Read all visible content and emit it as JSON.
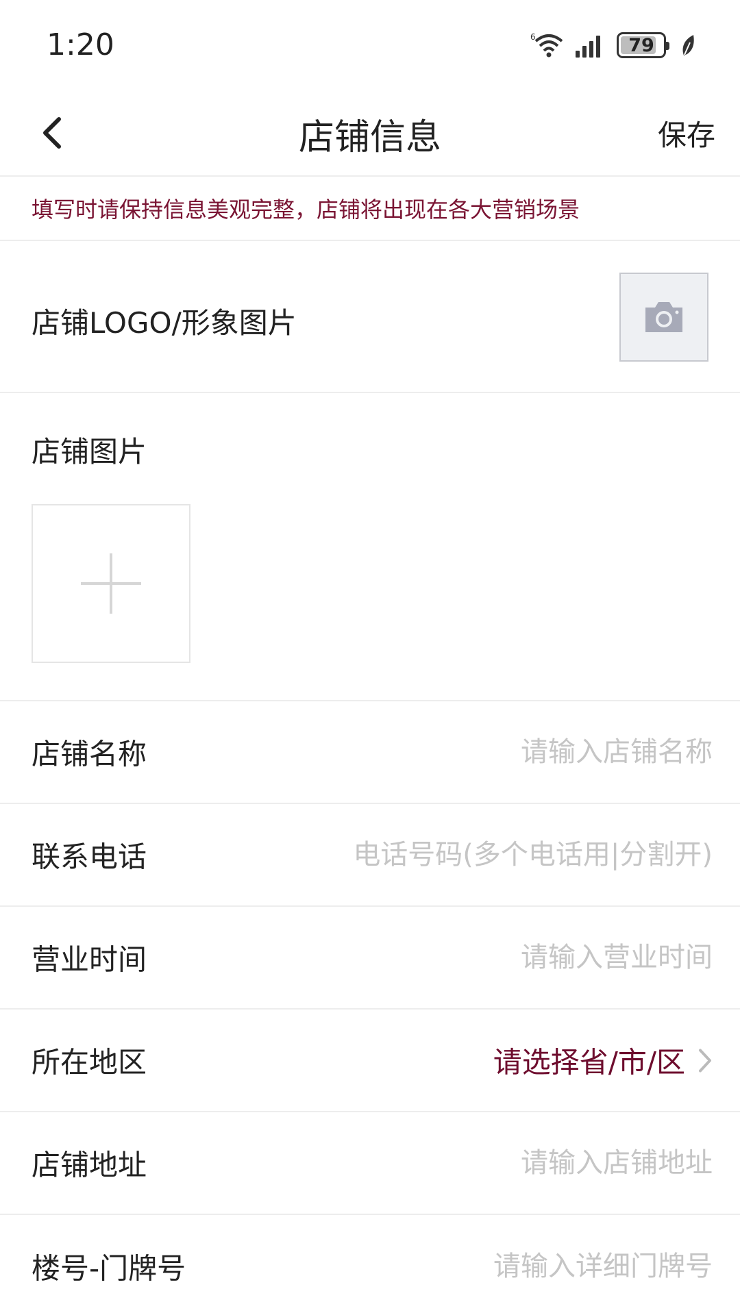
{
  "status_bar": {
    "time": "1:20",
    "battery": "79"
  },
  "header": {
    "title": "店铺信息",
    "save_label": "保存"
  },
  "notice": "填写时请保持信息美观完整，店铺将出现在各大营销场景",
  "logo_section": {
    "label": "店铺LOGO/形象图片"
  },
  "images_section": {
    "label": "店铺图片"
  },
  "form": {
    "name": {
      "label": "店铺名称",
      "placeholder": "请输入店铺名称"
    },
    "phone": {
      "label": "联系电话",
      "placeholder": "电话号码(多个电话用|分割开)"
    },
    "hours": {
      "label": "营业时间",
      "placeholder": "请输入营业时间"
    },
    "region": {
      "label": "所在地区",
      "value": "请选择省/市/区"
    },
    "address": {
      "label": "店铺地址",
      "placeholder": "请输入店铺地址"
    },
    "unit": {
      "label": "楼号-门牌号",
      "placeholder": "请输入详细门牌号"
    }
  },
  "colors": {
    "accent": "#7a1433",
    "placeholder": "#c5c5c5",
    "divider": "#ededed"
  }
}
